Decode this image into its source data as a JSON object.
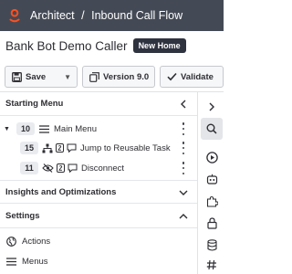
{
  "header": {
    "app": "Architect",
    "separator": "/",
    "flow_type": "Inbound Call Flow"
  },
  "flow": {
    "name": "Bank Bot Demo Caller",
    "home_badge": "New Home"
  },
  "toolbar": {
    "save_label": "Save",
    "version_label": "Version 9.0",
    "validate_label": "Validate"
  },
  "starting_menu": {
    "title": "Starting Menu",
    "main_menu": {
      "number": "10",
      "label": "Main Menu"
    },
    "items": [
      {
        "number": "15",
        "label": "Jump to Reusable Task"
      },
      {
        "number": "11",
        "label": "Disconnect"
      }
    ]
  },
  "insights": {
    "title": "Insights and Optimizations"
  },
  "settings": {
    "title": "Settings",
    "items": [
      {
        "label": "Actions",
        "icon": "globe-icon"
      },
      {
        "label": "Menus",
        "icon": "menu-icon"
      }
    ]
  },
  "colors": {
    "topbar": "#444a55",
    "logo": "#ff4f1f",
    "badge": "#2f3340"
  }
}
